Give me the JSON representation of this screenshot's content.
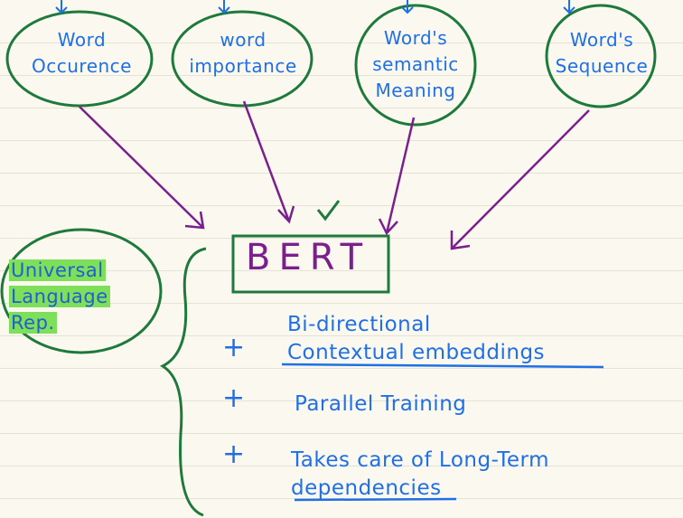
{
  "bubbles": [
    {
      "line1": "Word",
      "line2": "Occurence"
    },
    {
      "line1": "word",
      "line2": "importance"
    },
    {
      "line1": "Word's",
      "line2": "semantic",
      "line3": "Meaning"
    },
    {
      "line1": "Word's",
      "line2": "Sequence"
    }
  ],
  "center": {
    "label": "BERT"
  },
  "side_note": {
    "line1": "Universal",
    "line2": "Language",
    "line3": "Rep."
  },
  "points": [
    {
      "bullet": "+",
      "line1": "Bi-directional",
      "line2": "Contextual embeddings"
    },
    {
      "bullet": "+",
      "line1": "Parallel Training"
    },
    {
      "bullet": "+",
      "line1": "Takes care of Long-Term",
      "line2": "dependencies"
    }
  ],
  "colors": {
    "blue": "#1f6fe6",
    "green": "#1e7a3c",
    "purple": "#7b1f8e",
    "highlight": "#7ee05a"
  }
}
